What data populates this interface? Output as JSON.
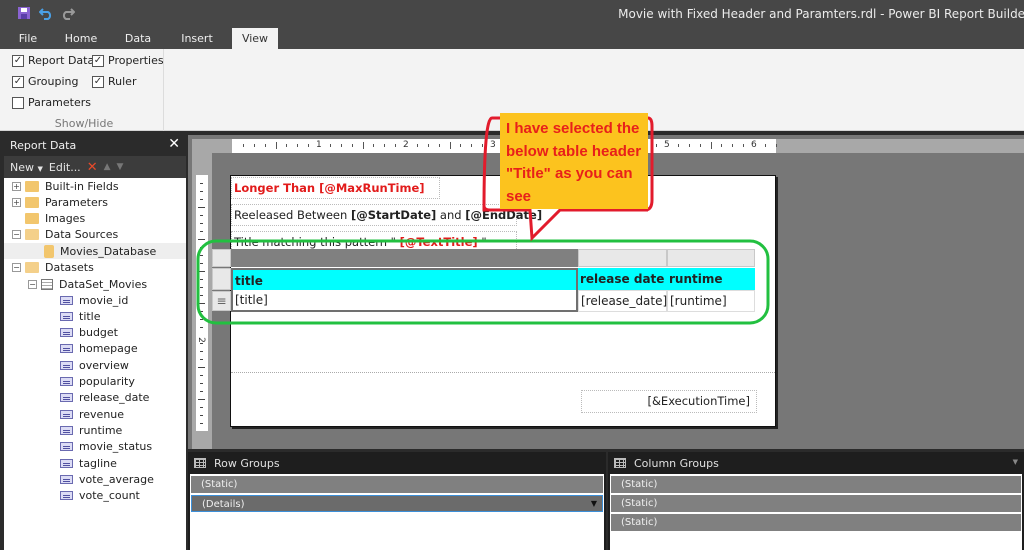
{
  "window": {
    "title": "Movie with Fixed Header and Paramters.rdl - Power BI Report Builder"
  },
  "quick_access": [
    "save-icon",
    "undo-icon",
    "redo-icon"
  ],
  "tabs": [
    {
      "label": "File",
      "active": false
    },
    {
      "label": "Home",
      "active": false
    },
    {
      "label": "Data",
      "active": false
    },
    {
      "label": "Insert",
      "active": false
    },
    {
      "label": "View",
      "active": true
    }
  ],
  "ribbon": {
    "group_label": "Show/Hide",
    "checkboxes": [
      {
        "label": "Report Data",
        "checked": true
      },
      {
        "label": "Properties",
        "checked": true
      },
      {
        "label": "Grouping",
        "checked": true
      },
      {
        "label": "Ruler",
        "checked": true
      },
      {
        "label": "Parameters",
        "checked": false
      }
    ]
  },
  "report_data": {
    "title": "Report Data",
    "close": "✕",
    "toolbar": {
      "new": "New",
      "edit": "Edit...",
      "delete": "✕",
      "up": "▲",
      "down": "▼"
    },
    "tree": [
      {
        "label": "Built-in Fields",
        "expander": "+"
      },
      {
        "label": "Parameters",
        "expander": "+"
      },
      {
        "label": "Images",
        "expander": ""
      },
      {
        "label": "Data Sources",
        "expander": "−"
      },
      {
        "label": "Movies_Database",
        "expander": ""
      },
      {
        "label": "Datasets",
        "expander": "−"
      },
      {
        "label": "DataSet_Movies",
        "expander": "−"
      }
    ],
    "fields": [
      "movie_id",
      "title",
      "budget",
      "homepage",
      "overview",
      "popularity",
      "release_date",
      "revenue",
      "runtime",
      "movie_status",
      "tagline",
      "vote_average",
      "vote_count"
    ]
  },
  "ruler": {
    "h_numbers": [
      "1",
      "2",
      "3",
      "4",
      "5",
      "6"
    ],
    "v_numbers": [
      "2"
    ]
  },
  "report": {
    "longer_than": "Longer Than [@MaxRunTime]",
    "released_prefix": "Reeleased Between ",
    "start_date": "[@StartDate]",
    "and": " and ",
    "end_date": "[@EndDate]",
    "title_match_prefix": "Title matching this pattern \" ",
    "text_title": "[@TextTitle]",
    "title_match_suffix": " \"",
    "execution_time": "[&ExecutionTime]",
    "table": {
      "headers": [
        "title",
        "release date",
        "runtime"
      ],
      "details": [
        "[title]",
        "[release_date]",
        "[runtime]"
      ],
      "row_handle": "≡"
    }
  },
  "callout": {
    "text": "I have selected the below table header \"Title\" as you can see"
  },
  "row_groups": {
    "title": "Row Groups",
    "items": [
      "(Static)",
      "(Details)"
    ]
  },
  "column_groups": {
    "title": "Column Groups",
    "items": [
      "(Static)",
      "(Static)",
      "(Static)"
    ]
  },
  "colors": {
    "header_cyan": "#00ffff",
    "callout_bg": "#fcc31e",
    "callout_text": "#e8201a",
    "highlight_green": "#22c040",
    "parameter_red": "#e21b1b"
  }
}
